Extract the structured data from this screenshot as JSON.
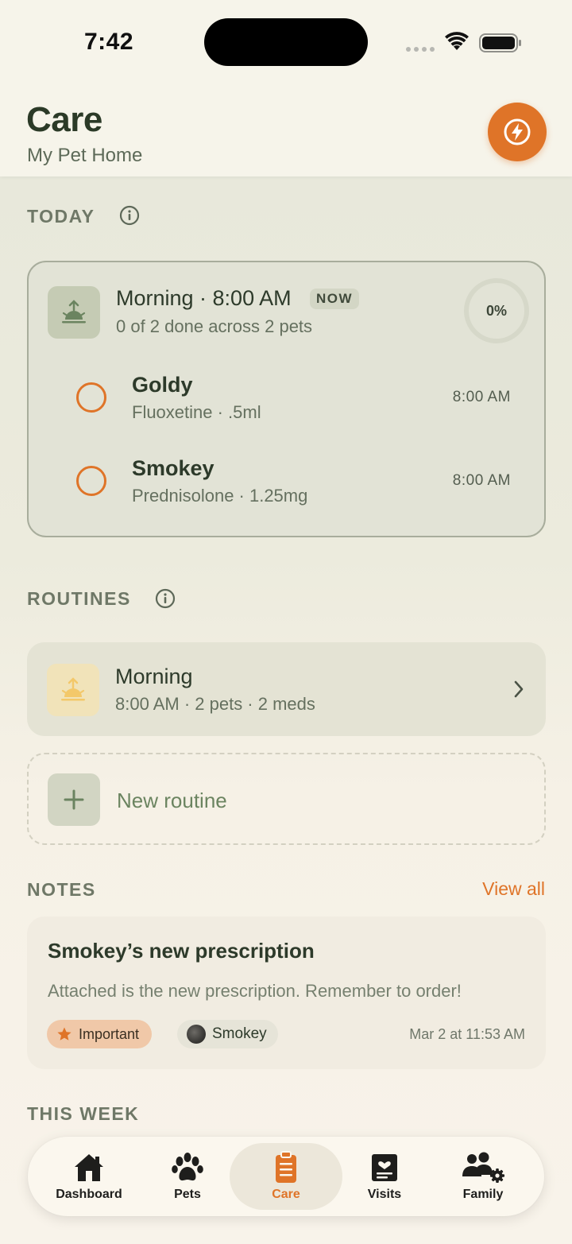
{
  "status_bar": {
    "time": "7:42"
  },
  "header": {
    "title": "Care",
    "subtitle": "My Pet Home"
  },
  "today": {
    "label": "TODAY",
    "slot": {
      "title": "Morning · 8:00 AM",
      "badge": "NOW",
      "summary": "0 of 2 done across 2 pets",
      "progress_text": "0%",
      "progress": 0
    },
    "items": [
      {
        "pet": "Goldy",
        "detail": "Fluoxetine · .5ml",
        "time": "8:00 AM",
        "done": false
      },
      {
        "pet": "Smokey",
        "detail": "Prednisolone · 1.25mg",
        "time": "8:00 AM",
        "done": false
      }
    ]
  },
  "routines": {
    "label": "ROUTINES",
    "items": [
      {
        "name": "Morning",
        "meta": "8:00 AM · 2 pets · 2 meds"
      }
    ],
    "new_label": "New routine"
  },
  "notes": {
    "label": "NOTES",
    "view_all": "View all",
    "items": [
      {
        "title": "Smokey’s new prescription",
        "body": "Attached is the new prescription. Remember to order!",
        "tag": "Important",
        "pet": "Smokey",
        "date": "Mar 2 at 11:53 AM"
      }
    ]
  },
  "this_week": {
    "label": "THIS WEEK"
  },
  "tabs": [
    {
      "label": "Dashboard",
      "icon": "house-icon"
    },
    {
      "label": "Pets",
      "icon": "paw-icon"
    },
    {
      "label": "Care",
      "icon": "clipboard-icon",
      "active": true
    },
    {
      "label": "Visits",
      "icon": "chart-card-icon"
    },
    {
      "label": "Family",
      "icon": "family-gear-icon"
    }
  ],
  "colors": {
    "accent": "#df7428",
    "text": "#2d3a2a",
    "muted": "#65705f",
    "card": "#e2e3d6"
  }
}
